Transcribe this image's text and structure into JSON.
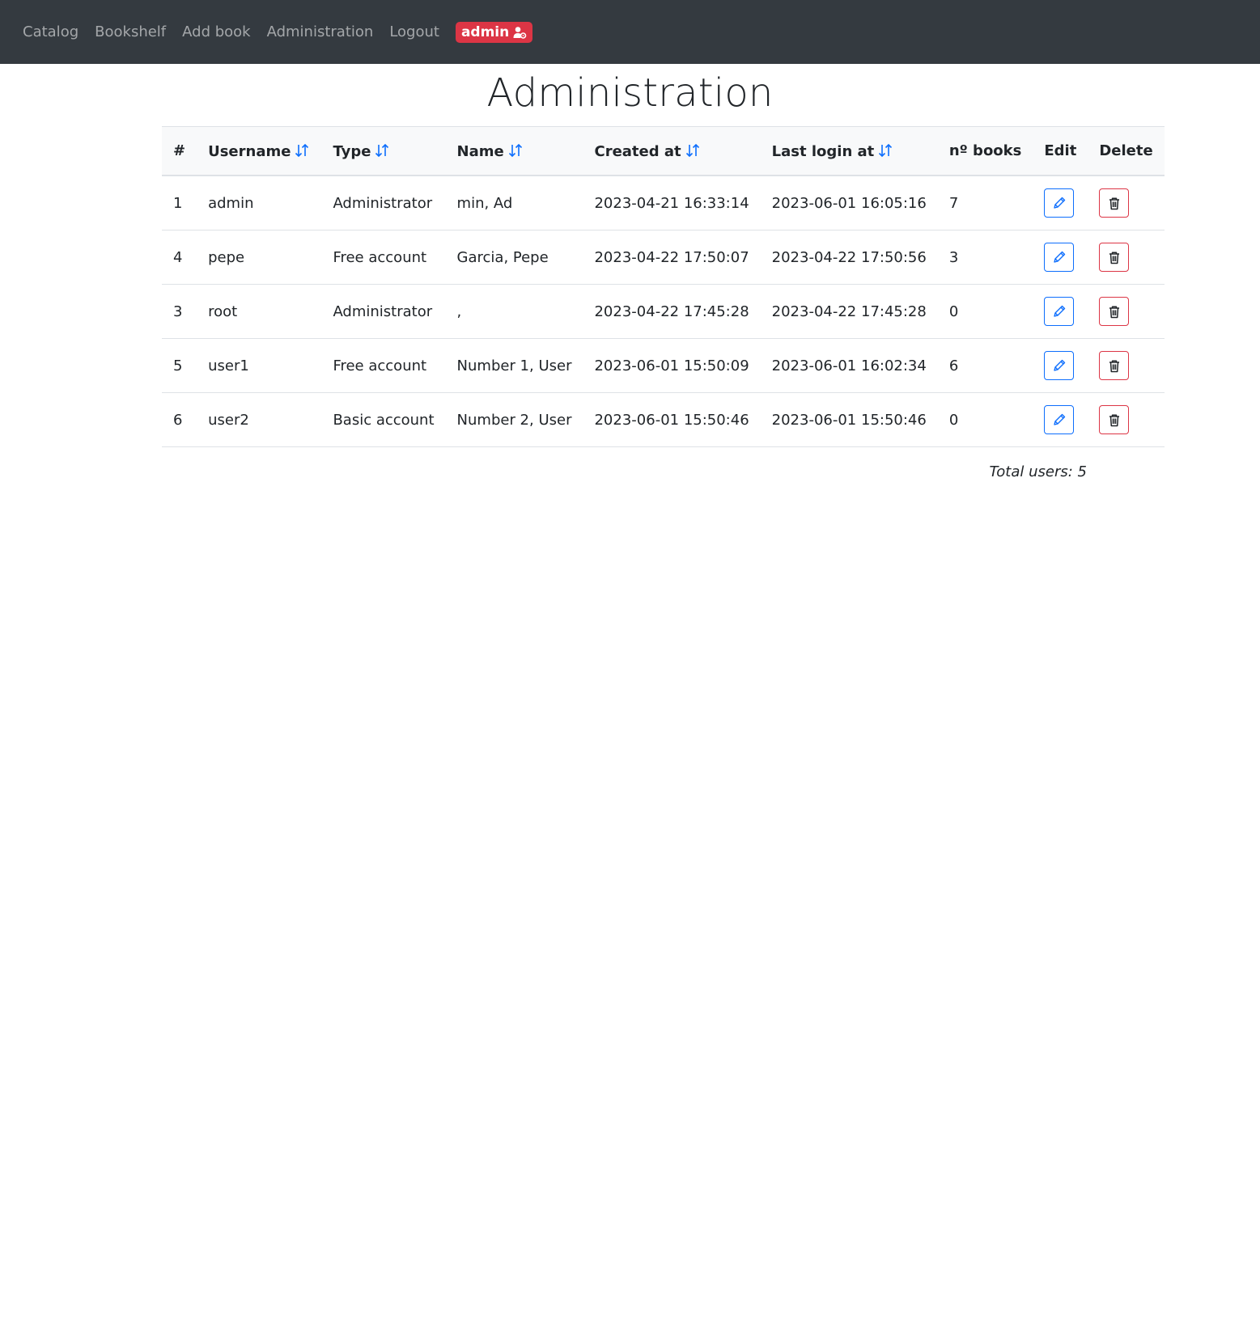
{
  "nav": {
    "links": [
      "Catalog",
      "Bookshelf",
      "Add book",
      "Administration",
      "Logout"
    ],
    "user_badge": "admin"
  },
  "page": {
    "title": "Administration"
  },
  "table": {
    "headers": [
      "#",
      "Username",
      "Type",
      "Name",
      "Created at",
      "Last login at",
      "nº books",
      "Edit",
      "Delete"
    ],
    "rows": [
      [
        "1",
        "admin",
        "Administrator",
        "min, Ad",
        "2023-04-21 16:33:14",
        "2023-06-01 16:05:16",
        "7"
      ],
      [
        "4",
        "pepe",
        "Free account",
        "Garcia, Pepe",
        "2023-04-22 17:50:07",
        "2023-04-22 17:50:56",
        "3"
      ],
      [
        "3",
        "root",
        "Administrator",
        ",",
        "2023-04-22 17:45:28",
        "2023-04-22 17:45:28",
        "0"
      ],
      [
        "5",
        "user1",
        "Free account",
        "Number 1, User",
        "2023-06-01 15:50:09",
        "2023-06-01 16:02:34",
        "6"
      ],
      [
        "6",
        "user2",
        "Basic account",
        "Number 2, User",
        "2023-06-01 15:50:46",
        "2023-06-01 15:50:46",
        "0"
      ]
    ],
    "total": "Total users: 5"
  },
  "colors": {
    "navbar": "#343a40",
    "badge": "#dc3545",
    "edit": "#0d6efd",
    "delete": "#dc3545"
  }
}
